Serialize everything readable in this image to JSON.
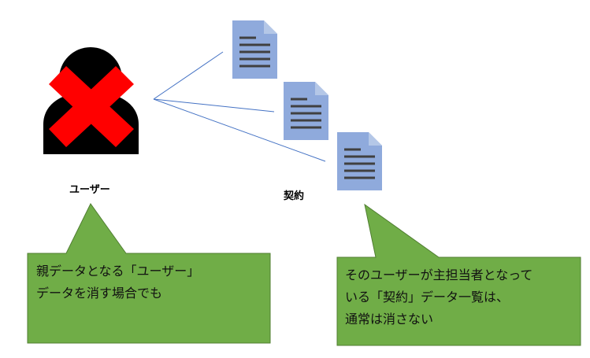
{
  "user": {
    "label": "ユーザー",
    "icon": "user-silhouette-icon",
    "overlay_icon": "red-x-icon"
  },
  "contracts": {
    "label": "契約",
    "icon": "document-icon",
    "count": 3
  },
  "callout_left": {
    "lines": [
      "親データとなる「ユーザー」",
      "データを消す場合でも"
    ]
  },
  "callout_right": {
    "lines": [
      "そのユーザーが主担当者となって",
      "いる「契約」データ一覧は、",
      "通常は消さない"
    ]
  },
  "colors": {
    "callout_fill": "#70ad47",
    "callout_stroke": "#507e32",
    "connector": "#4472c4",
    "doc_fill": "#8faadc",
    "doc_fold": "#b4c7e7",
    "doc_lines": "#404040",
    "user_fill": "#000000",
    "cross": "#ff0000"
  }
}
